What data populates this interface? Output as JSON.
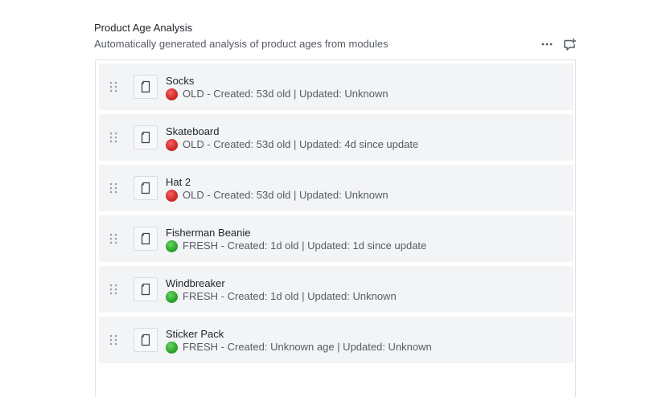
{
  "header": {
    "title": "Product Age Analysis",
    "subtitle": "Automatically generated analysis of product ages from modules"
  },
  "actions": [
    {
      "name": "more-options",
      "icon": "ellipsis-icon"
    },
    {
      "name": "add-comment",
      "icon": "comment-plus-icon"
    }
  ],
  "colors": {
    "old": "#d42a2a",
    "fresh": "#2ea72c"
  },
  "products": [
    {
      "name": "Socks",
      "status": "old",
      "meta": "OLD - Created: 53d old | Updated: Unknown"
    },
    {
      "name": "Skateboard",
      "status": "old",
      "meta": "OLD - Created: 53d old | Updated: 4d since update"
    },
    {
      "name": "Hat 2",
      "status": "old",
      "meta": "OLD - Created: 53d old | Updated: Unknown"
    },
    {
      "name": "Fisherman Beanie",
      "status": "fresh",
      "meta": "FRESH - Created: 1d old | Updated: 1d since update"
    },
    {
      "name": "Windbreaker",
      "status": "fresh",
      "meta": "FRESH - Created: 1d old | Updated: Unknown"
    },
    {
      "name": "Sticker Pack",
      "status": "fresh",
      "meta": "FRESH - Created: Unknown age | Updated: Unknown"
    }
  ]
}
